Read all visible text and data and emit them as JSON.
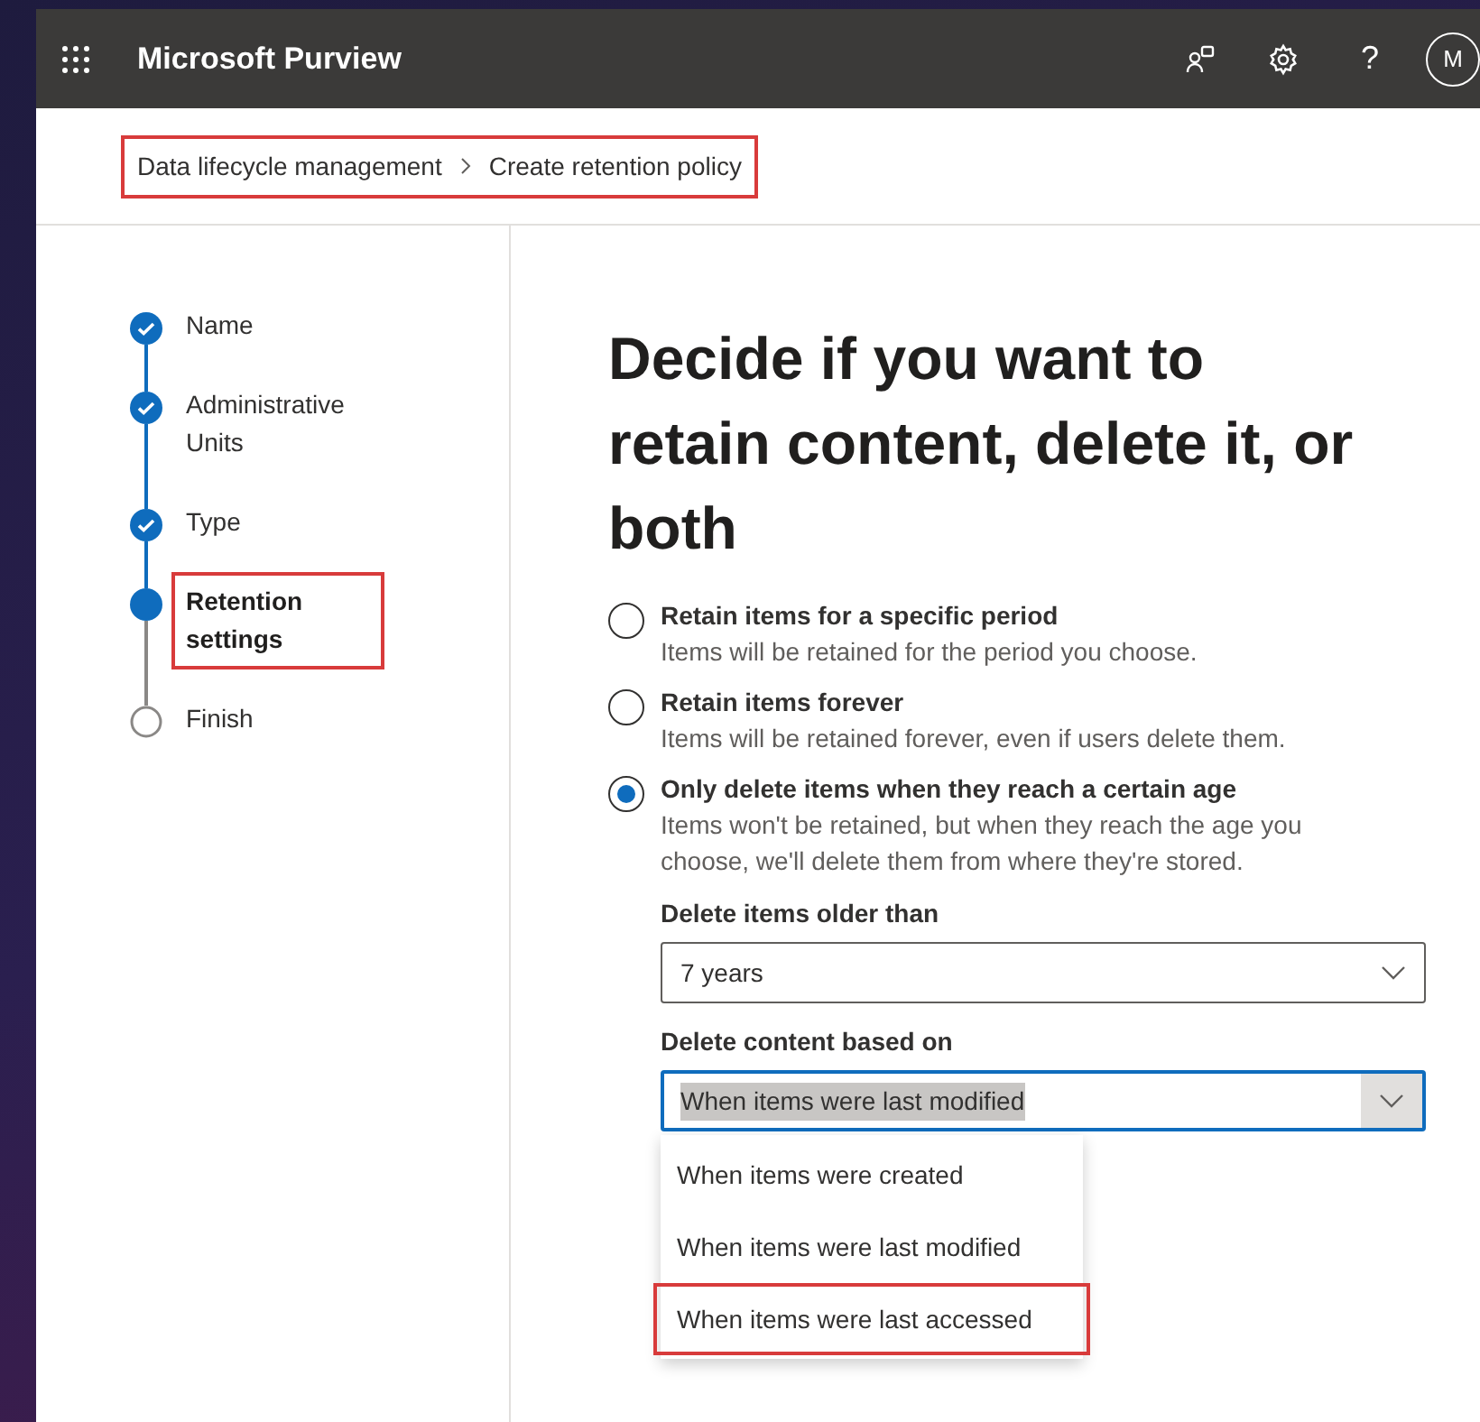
{
  "app_bar": {
    "title": "Microsoft Purview",
    "help": "?",
    "avatar": "M"
  },
  "breadcrumb": {
    "highlighted": true,
    "items": [
      "Data lifecycle management",
      "Create retention policy"
    ]
  },
  "steps": [
    {
      "label": "Name",
      "kind": "done",
      "highlighted": false
    },
    {
      "label": "Administrative Units",
      "kind": "done",
      "highlighted": false
    },
    {
      "label": "Type",
      "kind": "done",
      "highlighted": false
    },
    {
      "label": "Retention settings",
      "kind": "current",
      "highlighted": true
    },
    {
      "label": "Finish",
      "kind": "pending",
      "highlighted": false
    }
  ],
  "heading": "Decide if you want to retain content, delete it, or both",
  "options": [
    {
      "label": "Retain items for a specific period",
      "description": "Items will be retained for the period you choose.",
      "selected": false
    },
    {
      "label": "Retain items forever",
      "description": "Items will be retained forever, even if users delete them.",
      "selected": false
    },
    {
      "label": "Only delete items when they reach a certain age",
      "description": "Items won't be retained, but when they reach the age you choose, we'll delete them from where they're stored.",
      "selected": true
    }
  ],
  "age_field": {
    "label": "Delete items older than",
    "value": "7 years"
  },
  "basis_field": {
    "label": "Delete content based on",
    "value": "When items were last modified",
    "expanded": true,
    "menu": [
      {
        "label": "When items were created",
        "highlighted": false
      },
      {
        "label": "When items were last modified",
        "highlighted": false
      },
      {
        "label": "When items were last accessed",
        "highlighted": true
      }
    ]
  }
}
